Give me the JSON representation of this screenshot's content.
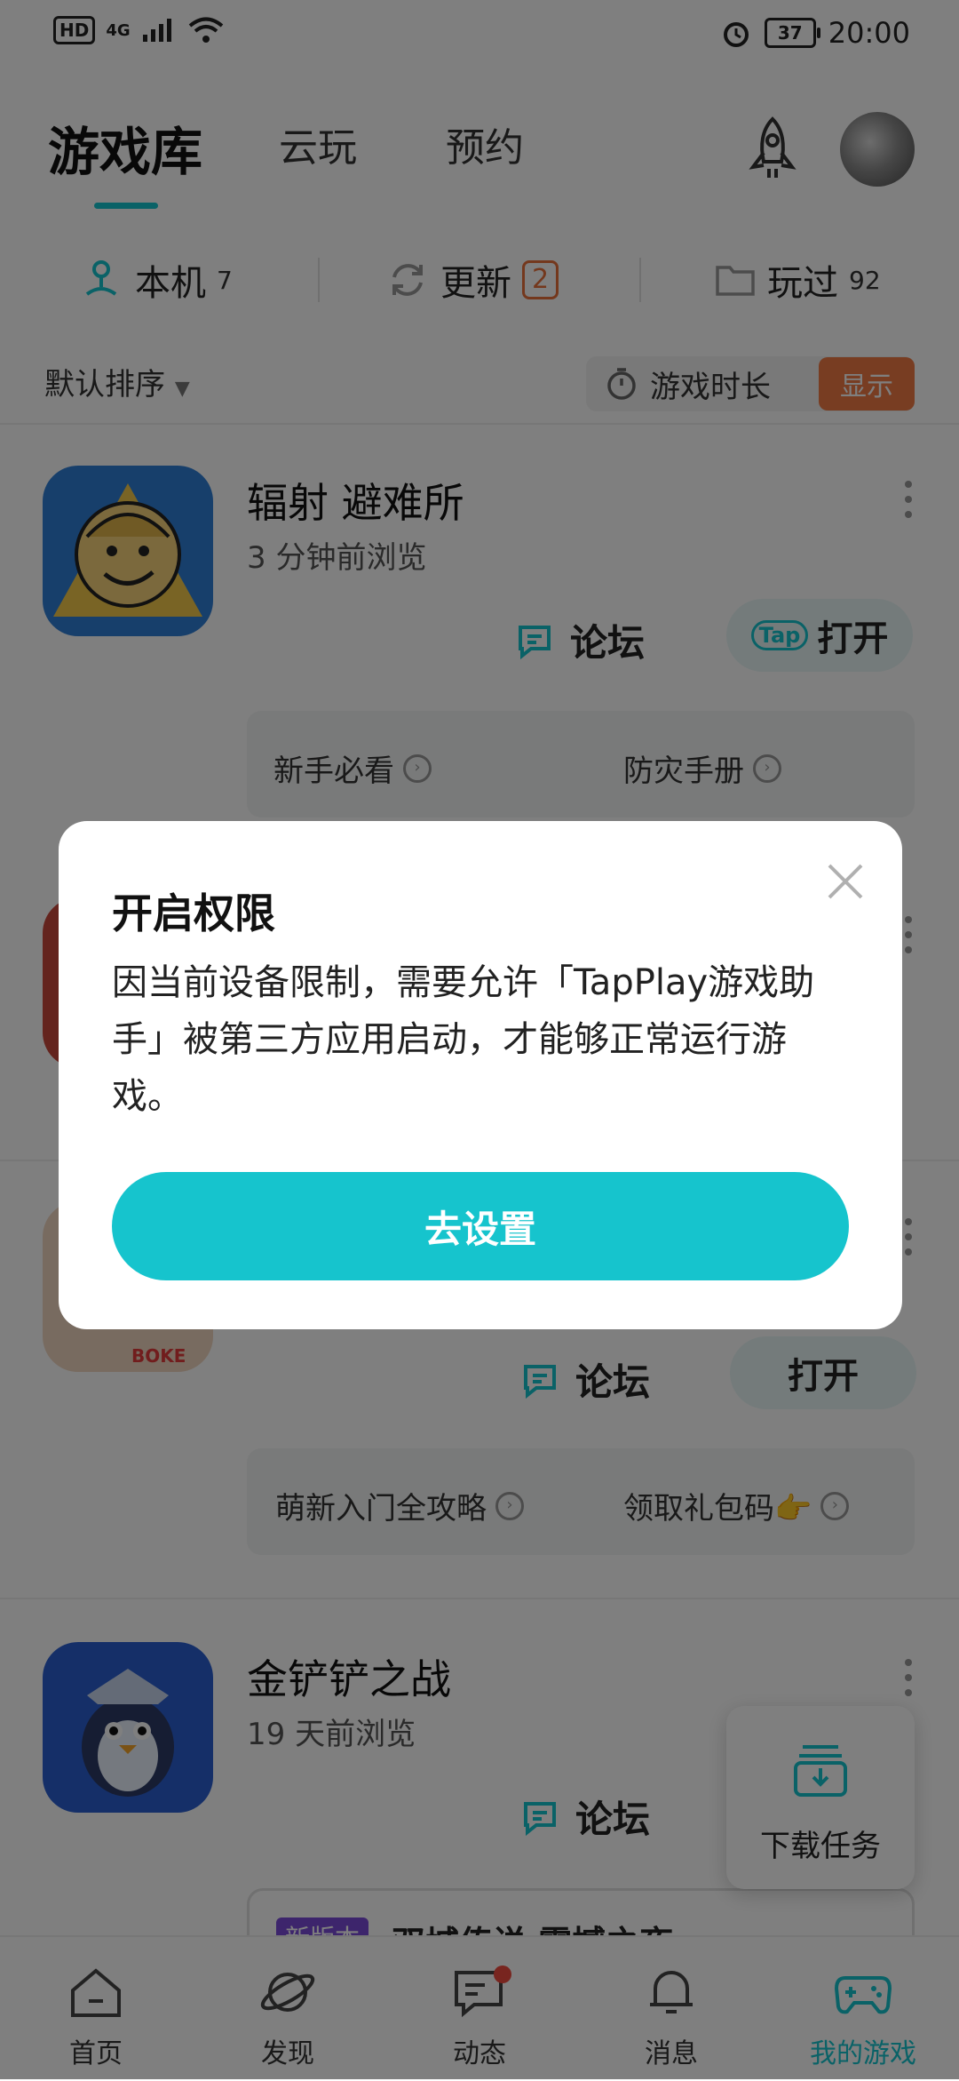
{
  "status_bar": {
    "hd": "HD",
    "network": "4G",
    "battery": "37",
    "time": "20:00"
  },
  "top_nav": {
    "tabs": [
      "游戏库",
      "云玩",
      "预约"
    ]
  },
  "filters": [
    {
      "label": "本机",
      "count": "7"
    },
    {
      "label": "更新",
      "count": "2"
    },
    {
      "label": "玩过",
      "count": "92"
    }
  ],
  "sort": {
    "label": "默认排序"
  },
  "duration": {
    "label": "游戏时长",
    "button": "显示"
  },
  "games": [
    {
      "title": "辐射 避难所",
      "subtitle": "3 分钟前浏览",
      "forum": "论坛",
      "open": "打开",
      "open_prefix": "Tap",
      "links": [
        "新手必看",
        "防灾手册"
      ]
    },
    {
      "forum": "论坛",
      "open": "打开",
      "links": [
        "萌新入门全攻略",
        "领取礼包码👉"
      ],
      "icon_text": "BOKE"
    },
    {
      "title": "金铲铲之战",
      "subtitle": "19 天前浏览",
      "forum": "论坛"
    }
  ],
  "download_task": {
    "label": "下载任务"
  },
  "banner": {
    "tag": "新版本",
    "text": "双城传说 震撼之夜"
  },
  "bottom_nav": [
    "首页",
    "发现",
    "动态",
    "消息",
    "我的游戏"
  ],
  "dialog": {
    "title": "开启权限",
    "body": "因当前设备限制，需要允许「TapPlay游戏助手」被第三方应用启动，才能够正常运行游戏。",
    "button": "去设置"
  },
  "colors": {
    "accent": "#16c4cd",
    "badge": "#e8713a",
    "show_button": "#f07a44",
    "dot": "#f04b3e"
  }
}
